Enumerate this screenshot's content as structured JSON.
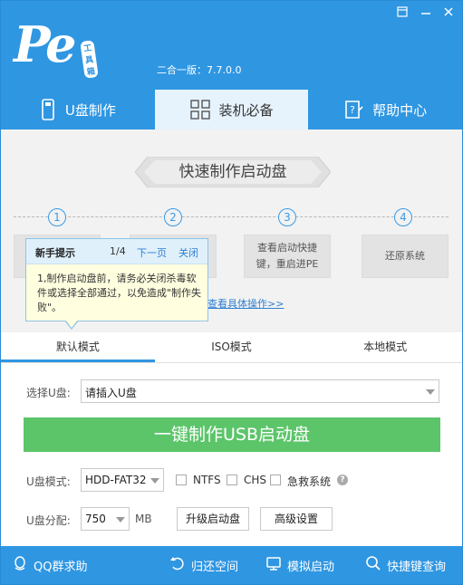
{
  "header": {
    "logo_text": "Pe",
    "logo_tag": "工具箱",
    "version": "二合一版：7.7.0.0",
    "controls": {
      "skin_icon": "skin-icon",
      "minimize_icon": "minimize-icon",
      "close_icon": "close-icon"
    }
  },
  "tabs": [
    {
      "label": "U盘制作",
      "icon": "usb-drive-icon"
    },
    {
      "label": "装机必备",
      "icon": "grid-apps-icon"
    },
    {
      "label": "帮助中心",
      "icon": "help-document-icon"
    }
  ],
  "guide": {
    "banner": "快速制作启动盘",
    "steps": [
      {
        "num": "1",
        "text": "选择U盘\n作"
      },
      {
        "num": "2",
        "text": ""
      },
      {
        "num": "3",
        "text": "查看启动快捷\n键，重启进PE"
      },
      {
        "num": "4",
        "text": "还原系统"
      }
    ],
    "link": "查看具体操作>>"
  },
  "tooltip": {
    "title": "新手提示",
    "page": "1/4",
    "next": "下一页",
    "close": "关闭",
    "body": "1,制作启动盘前，请务必关闭杀毒软件或选择全部通过，以免造成\"制作失败\"。"
  },
  "modes": [
    {
      "label": "默认模式",
      "active": true
    },
    {
      "label": "ISO模式",
      "active": false
    },
    {
      "label": "本地模式",
      "active": false
    }
  ],
  "form": {
    "select_usb_label": "选择U盘:",
    "select_usb_value": "请插入U盘",
    "make_button": "一键制作USB启动盘",
    "usb_mode_label": "U盘模式:",
    "usb_mode_value": "HDD-FAT32",
    "ntfs_label": "NTFS",
    "chs_label": "CHS",
    "emergency_label": "急救系统",
    "help_mark": "?",
    "partition_label": "U盘分配:",
    "partition_value": "750",
    "partition_unit": "MB",
    "upgrade_button": "升级启动盘",
    "advanced_button": "高级设置"
  },
  "footer": [
    {
      "label": "QQ群求助",
      "icon": "qq-icon"
    },
    {
      "label": "归还空间",
      "icon": "restore-icon"
    },
    {
      "label": "模拟启动",
      "icon": "monitor-icon"
    },
    {
      "label": "快捷键查询",
      "icon": "search-icon"
    }
  ],
  "colors": {
    "primary": "#2f96e2",
    "green": "#5cc56a",
    "link": "#2f7fd0"
  }
}
